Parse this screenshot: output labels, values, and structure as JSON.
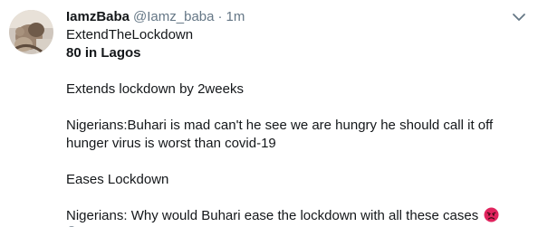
{
  "tweet": {
    "display_name": "IamzBaba",
    "handle": "@Iamz_baba",
    "separator": "·",
    "timestamp": "1m",
    "lines": {
      "l1": "ExtendTheLockdown",
      "l2": "80 in Lagos",
      "l3": "Extends lockdown by 2weeks",
      "l4": "Nigerians:Buhari is mad can't he see we are hungry he should call it off hunger virus is worst than covid-19",
      "l5": "Eases Lockdown",
      "l6": "Nigerians: Why would Buhari ease the lockdown with all these cases"
    },
    "emoji": "angry-face-emoji",
    "colors": {
      "text": "#14171a",
      "secondary": "#657786",
      "emoji": "#e0245e"
    }
  },
  "icons": {
    "menu": "chevron-down-icon",
    "avatar": "avatar"
  }
}
